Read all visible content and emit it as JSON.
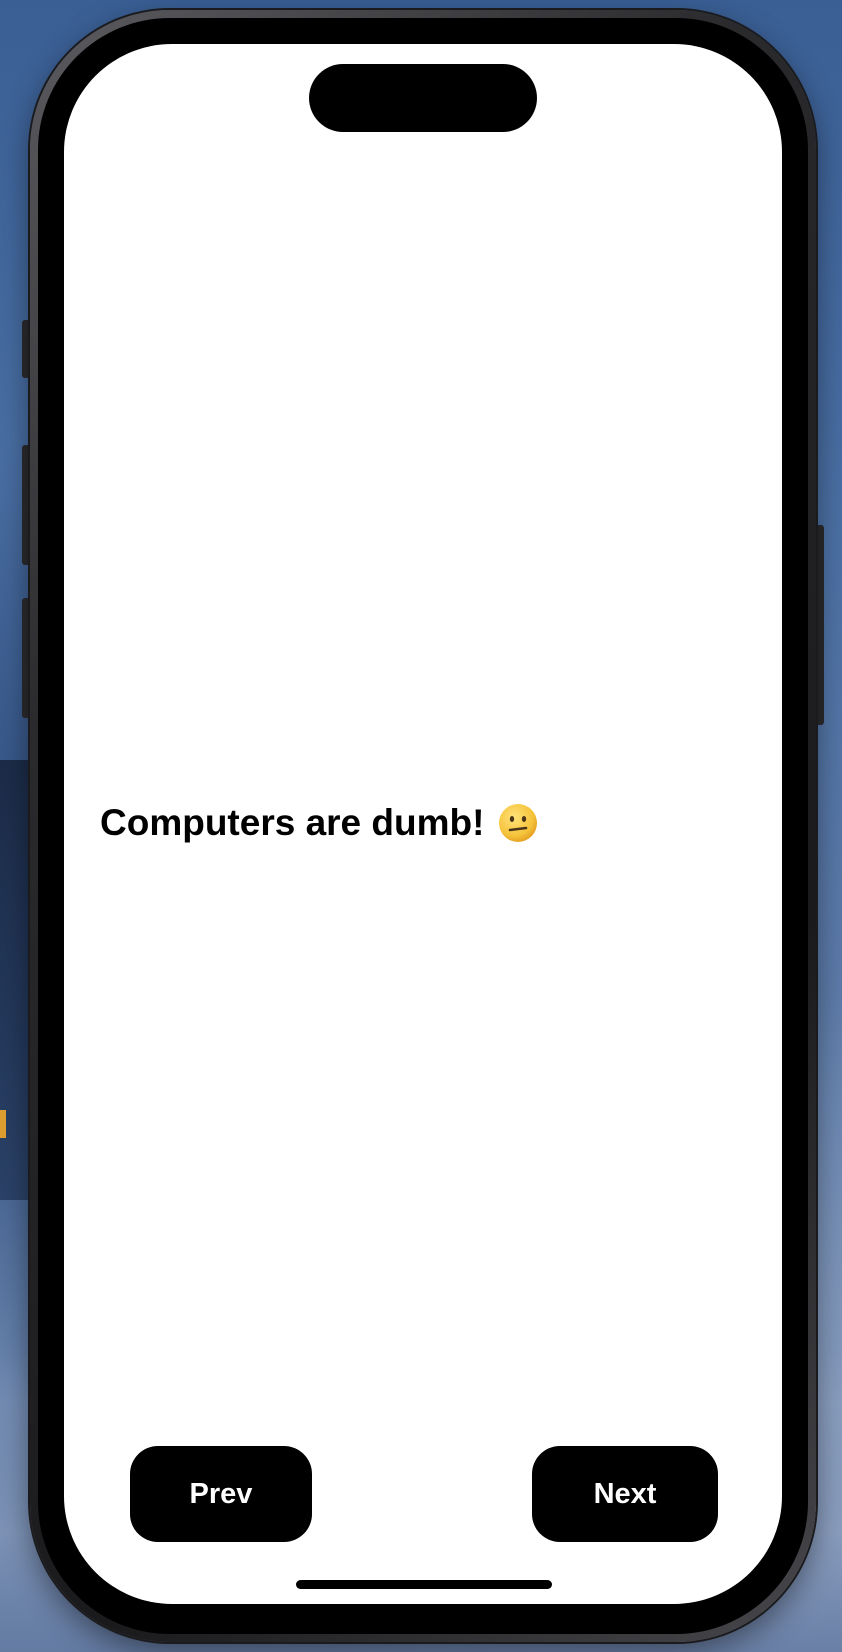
{
  "screen": {
    "message": "Computers are dumb!",
    "message_icon": "neutral-face-emoji-icon"
  },
  "navigation": {
    "prev_label": "Prev",
    "next_label": "Next"
  },
  "colors": {
    "screen_background": "#ffffff",
    "button_background": "#000000",
    "button_text": "#ffffff",
    "text": "#000000",
    "emoji_face": "#f5c33b",
    "wallpaper": "#4a6fa3"
  }
}
